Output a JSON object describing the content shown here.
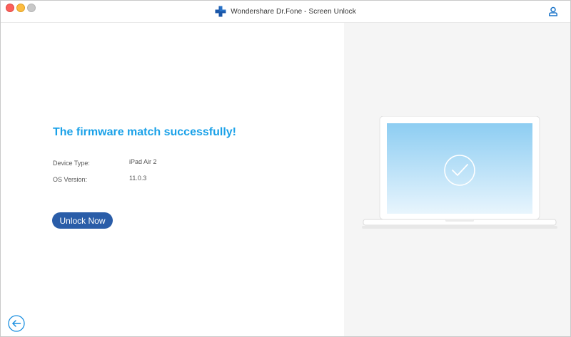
{
  "window": {
    "title": "Wondershare Dr.Fone - Screen Unlock"
  },
  "main": {
    "headline": "The firmware match successfully!",
    "device_type_label": "Device Type:",
    "device_type_value": "iPad Air 2",
    "os_version_label": "OS Version:",
    "os_version_value": "11.0.3",
    "unlock_button": "Unlock Now"
  },
  "icons": {
    "app_logo": "drfone-cross-icon",
    "user": "user-icon",
    "back": "back-arrow-icon",
    "success": "checkmark-circle-icon"
  },
  "colors": {
    "headline": "#1aa1e8",
    "button": "#2a5da8",
    "logo": "#1a56a8",
    "screen_top": "#8dcdf2",
    "screen_bottom": "#e8f5fd"
  }
}
